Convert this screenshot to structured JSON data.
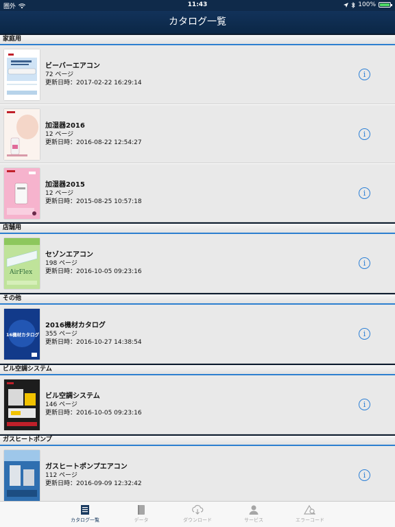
{
  "status_bar": {
    "carrier": "圏外",
    "time": "11:43",
    "battery": "100%"
  },
  "nav": {
    "title": "カタログ一覧"
  },
  "sections": [
    {
      "label": "家庭用",
      "items": [
        {
          "title": "ビーバーエアコン",
          "pages": "72 ページ",
          "updated": "更新日時：2017-02-22 16:29:14"
        },
        {
          "title": "加湿器2016",
          "pages": "12 ページ",
          "updated": "更新日時：2016-08-22 12:54:27"
        },
        {
          "title": "加湿器2015",
          "pages": "12 ページ",
          "updated": "更新日時：2015-08-25 10:57:18"
        }
      ]
    },
    {
      "label": "店舗用",
      "items": [
        {
          "title": "セゾンエアコン",
          "pages": "198 ページ",
          "updated": "更新日時：2016-10-05 09:23:16",
          "cover_text": "AirFlex"
        }
      ]
    },
    {
      "label": "その他",
      "items": [
        {
          "title": "2016機材カタログ",
          "pages": "355 ページ",
          "updated": "更新日時：2016-10-27 14:38:54",
          "cover_text": "16機材カタログ"
        }
      ]
    },
    {
      "label": "ビル空調システム",
      "items": [
        {
          "title": "ビル空調システム",
          "pages": "146 ページ",
          "updated": "更新日時：2016-10-05 09:23:16"
        }
      ]
    },
    {
      "label": "ガスヒートポンプ",
      "items": [
        {
          "title": "ガスヒートポンプエアコン",
          "pages": "112 ページ",
          "updated": "更新日時：2016-09-09 12:32:42"
        }
      ]
    }
  ],
  "tabs": [
    {
      "label": "カタログ一覧",
      "icon": "catalog-list-icon",
      "active": true
    },
    {
      "label": "データ",
      "icon": "data-book-icon",
      "active": false
    },
    {
      "label": "ダウンロード",
      "icon": "cloud-download-icon",
      "active": false
    },
    {
      "label": "サービス",
      "icon": "service-person-icon",
      "active": false
    },
    {
      "label": "エラーコード",
      "icon": "error-code-icon",
      "active": false
    }
  ],
  "colors": {
    "nav_background": "#0f2a4a",
    "accent_blue": "#2b7fd6",
    "tab_active": "#1a3b60",
    "tab_inactive": "#a6a6a6"
  }
}
